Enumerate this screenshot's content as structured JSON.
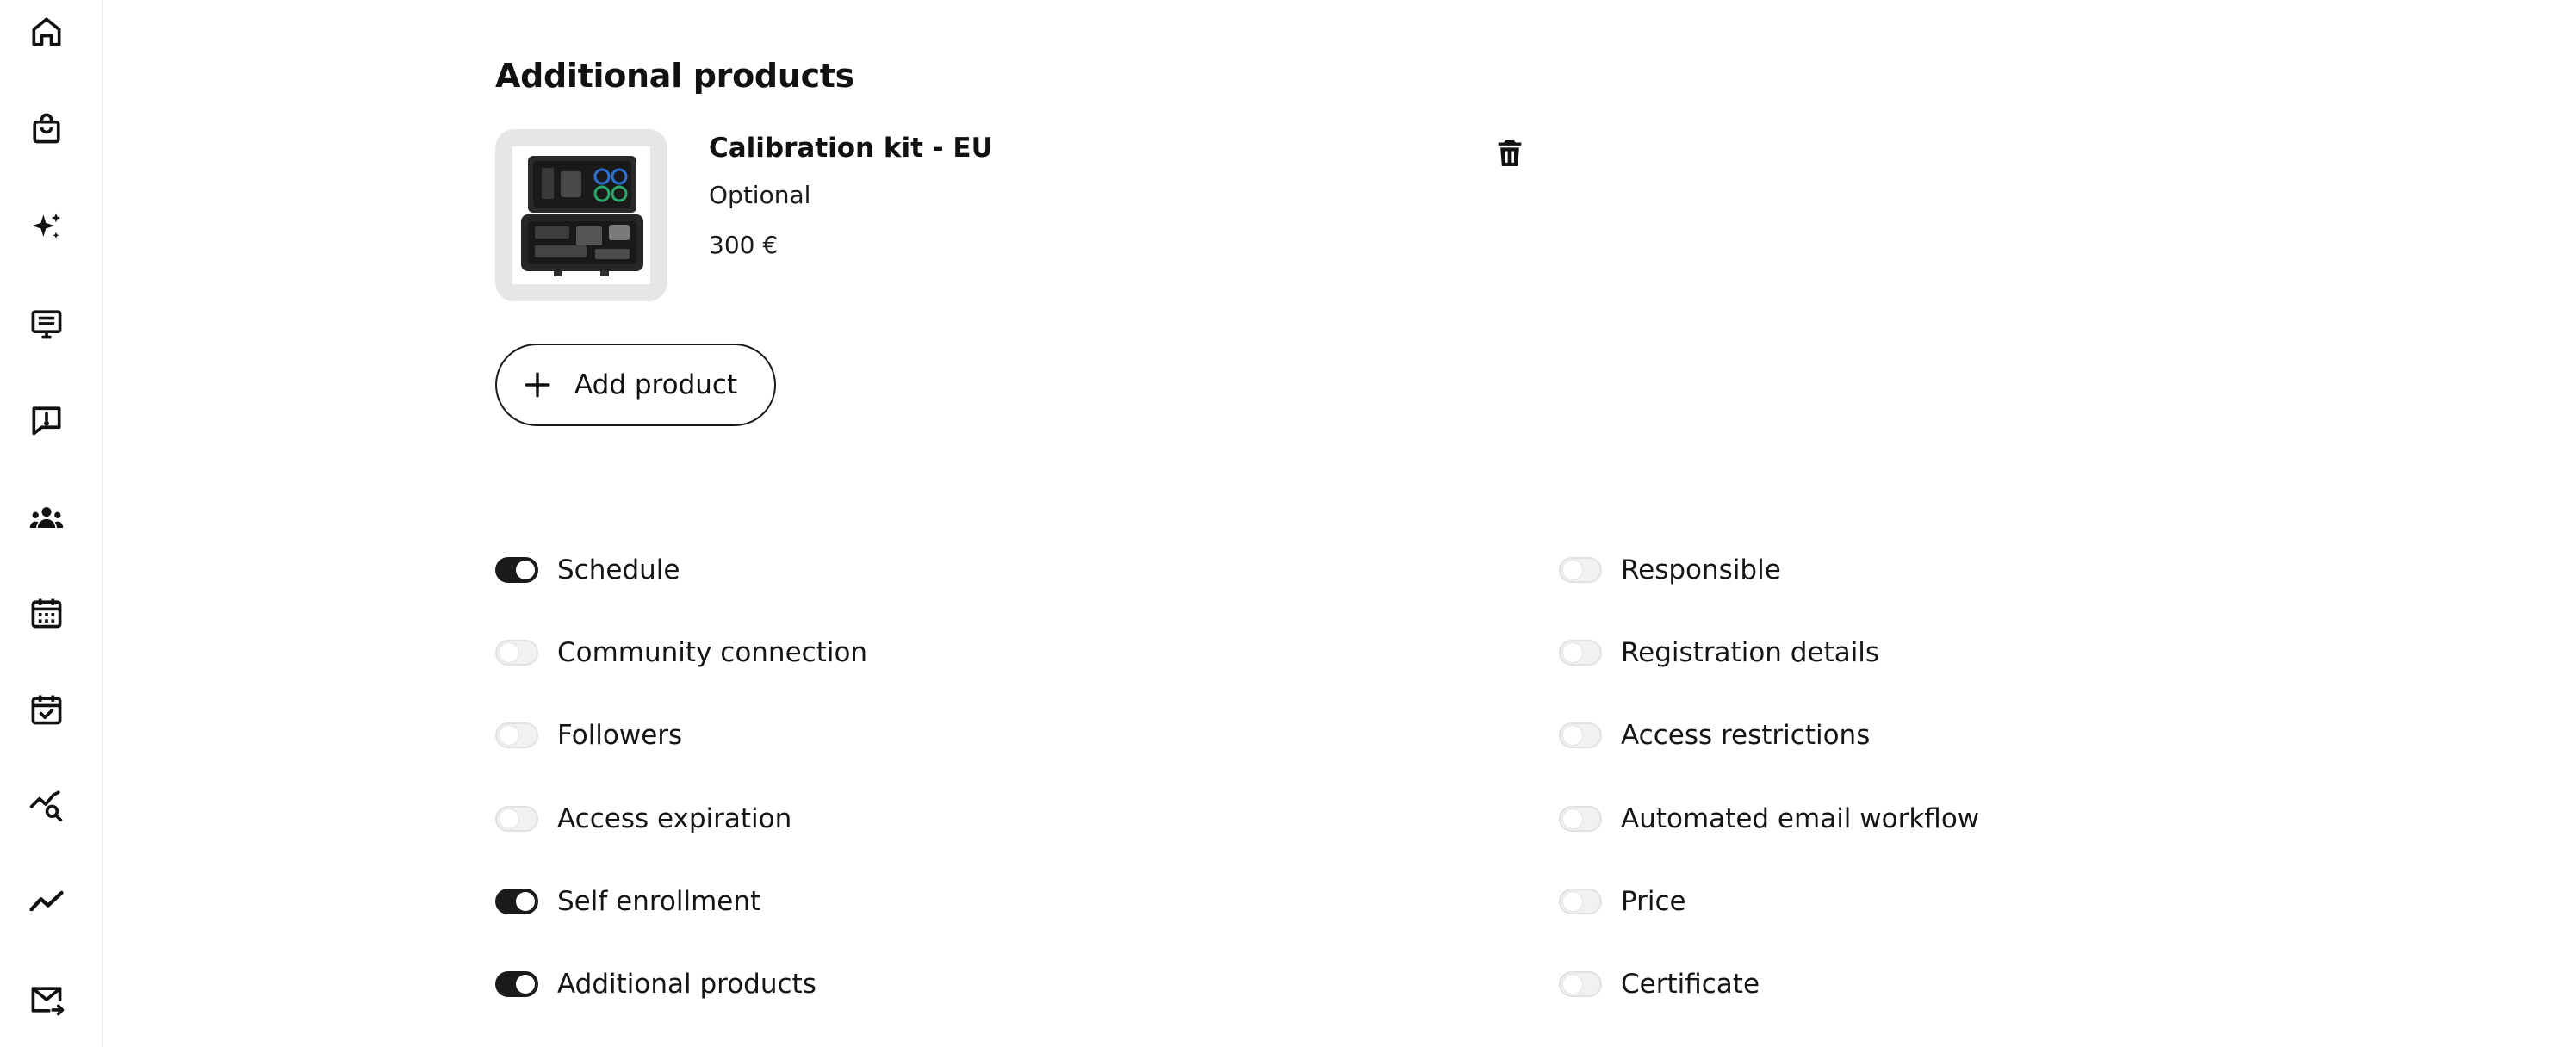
{
  "sidebar": {
    "items": [
      {
        "icon": "home-icon"
      },
      {
        "icon": "shopping-bag-icon"
      },
      {
        "icon": "sparkles-icon"
      },
      {
        "icon": "presentation-icon"
      },
      {
        "icon": "feedback-icon"
      },
      {
        "icon": "users-icon"
      },
      {
        "icon": "calendar-icon"
      },
      {
        "icon": "calendar-check-icon"
      },
      {
        "icon": "analytics-search-icon"
      },
      {
        "icon": "trend-line-icon"
      },
      {
        "icon": "mail-forward-icon"
      }
    ]
  },
  "section": {
    "title": "Additional products"
  },
  "product": {
    "name": "Calibration kit - EU",
    "tag": "Optional",
    "price": "300 €"
  },
  "add_product_label": "Add product",
  "toggles": {
    "left": [
      {
        "label": "Schedule",
        "on": true
      },
      {
        "label": "Community connection",
        "on": false
      },
      {
        "label": "Followers",
        "on": false
      },
      {
        "label": "Access expiration",
        "on": false
      },
      {
        "label": "Self enrollment",
        "on": true
      },
      {
        "label": "Additional products",
        "on": true
      }
    ],
    "right": [
      {
        "label": "Responsible",
        "on": false
      },
      {
        "label": "Registration details",
        "on": false
      },
      {
        "label": "Access restrictions",
        "on": false
      },
      {
        "label": "Automated email workflow",
        "on": false
      },
      {
        "label": "Price",
        "on": false
      },
      {
        "label": "Certificate",
        "on": false
      }
    ]
  },
  "colors": {
    "toggle_on": "#1b1b1b",
    "toggle_off": "#f1f1f1",
    "thumb_bg": "#e6e6e6"
  }
}
